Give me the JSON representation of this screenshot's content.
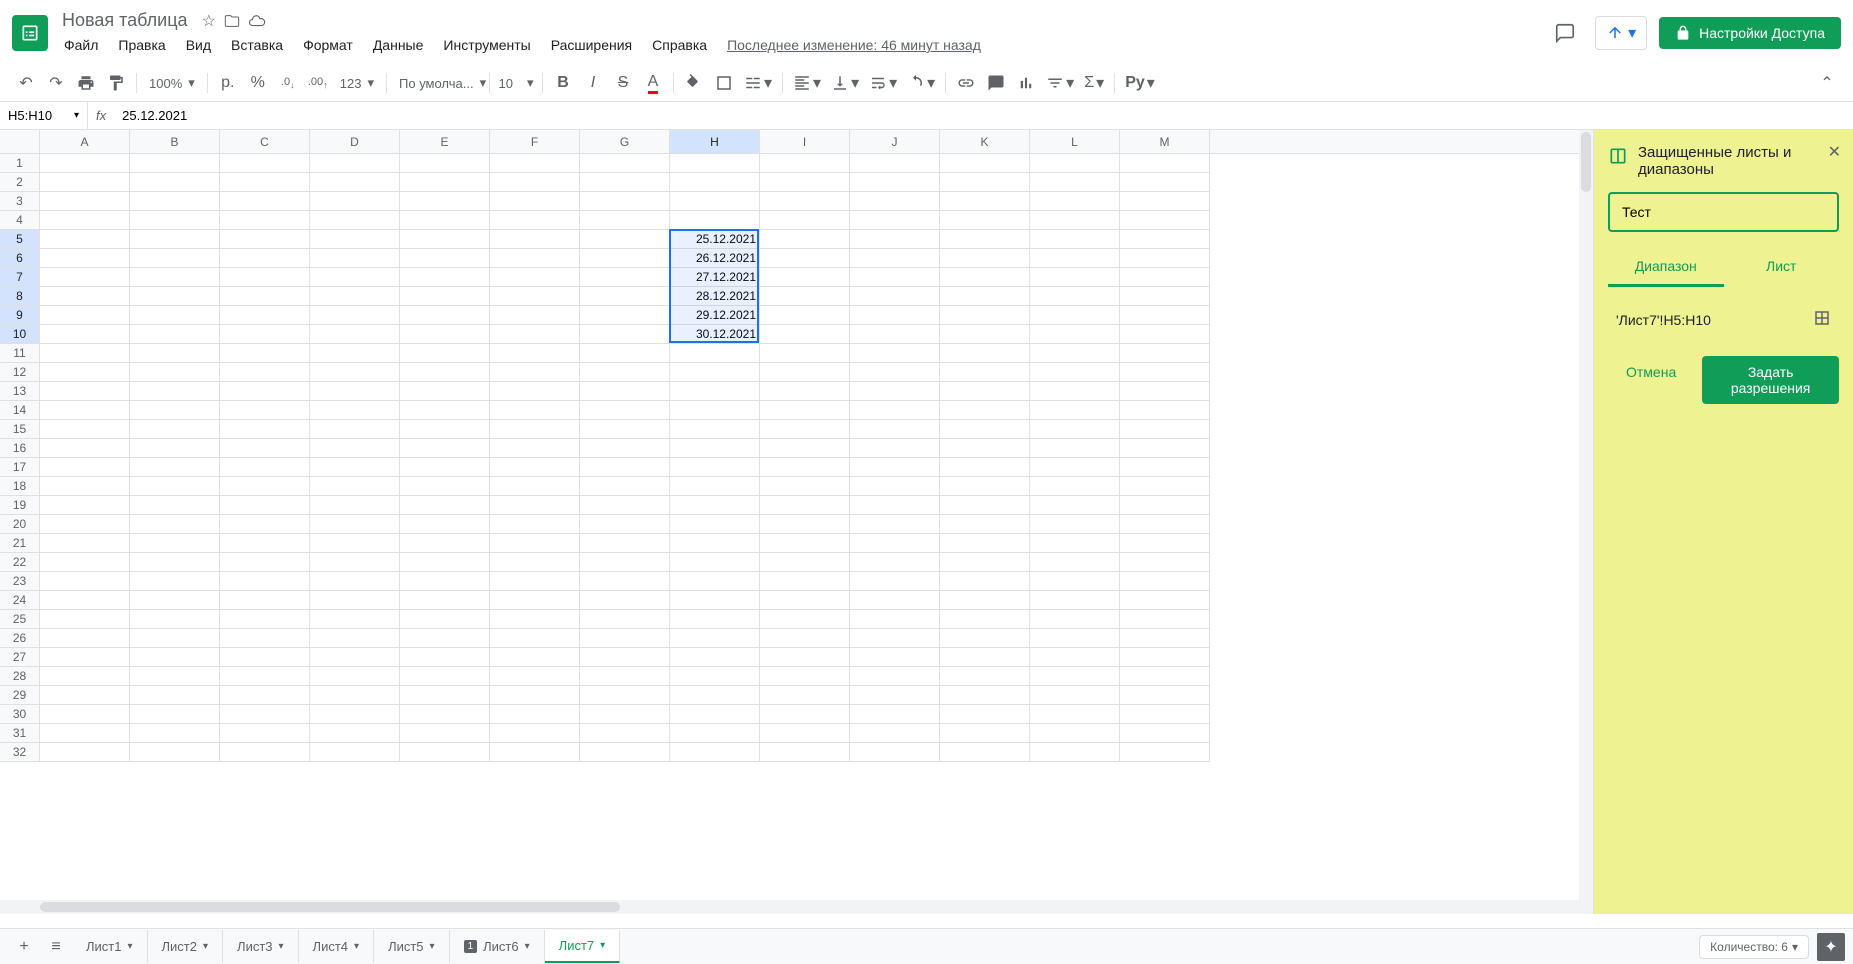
{
  "header": {
    "title": "Новая таблица",
    "menu": [
      "Файл",
      "Правка",
      "Вид",
      "Вставка",
      "Формат",
      "Данные",
      "Инструменты",
      "Расширения",
      "Справка"
    ],
    "last_edit": "Последнее изменение: 46 минут назад",
    "share_label": "Настройки Доступа"
  },
  "toolbar": {
    "zoom": "100%",
    "currency": "р.",
    "percent": "%",
    "decimal_dec": ".0",
    "decimal_inc": ".00",
    "format_num": "123",
    "font": "По умолча...",
    "font_size": "10",
    "robot": "Ру"
  },
  "formula_bar": {
    "name_box": "H5:H10",
    "fx": "fx",
    "value": "25.12.2021"
  },
  "grid": {
    "columns": [
      "A",
      "B",
      "C",
      "D",
      "E",
      "F",
      "G",
      "H",
      "I",
      "J",
      "K",
      "L",
      "M"
    ],
    "rows": 32,
    "selected_col": "H",
    "selected_rows": [
      5,
      6,
      7,
      8,
      9,
      10
    ],
    "data": {
      "H5": "25.12.2021",
      "H6": "26.12.2021",
      "H7": "27.12.2021",
      "H8": "28.12.2021",
      "H9": "29.12.2021",
      "H10": "30.12.2021"
    }
  },
  "sidebar": {
    "title": "Защищенные листы и диапазоны",
    "input_value": "Тест",
    "tab_range": "Диапазон",
    "tab_sheet": "Лист",
    "range_value": "'Лист7'!H5:H10",
    "cancel": "Отмена",
    "confirm": "Задать разрешения"
  },
  "sheets": {
    "tabs": [
      "Лист1",
      "Лист2",
      "Лист3",
      "Лист4",
      "Лист5",
      "Лист6",
      "Лист7"
    ],
    "active": "Лист7",
    "badge_6": "Лист6",
    "count_label": "Количество: 6"
  }
}
